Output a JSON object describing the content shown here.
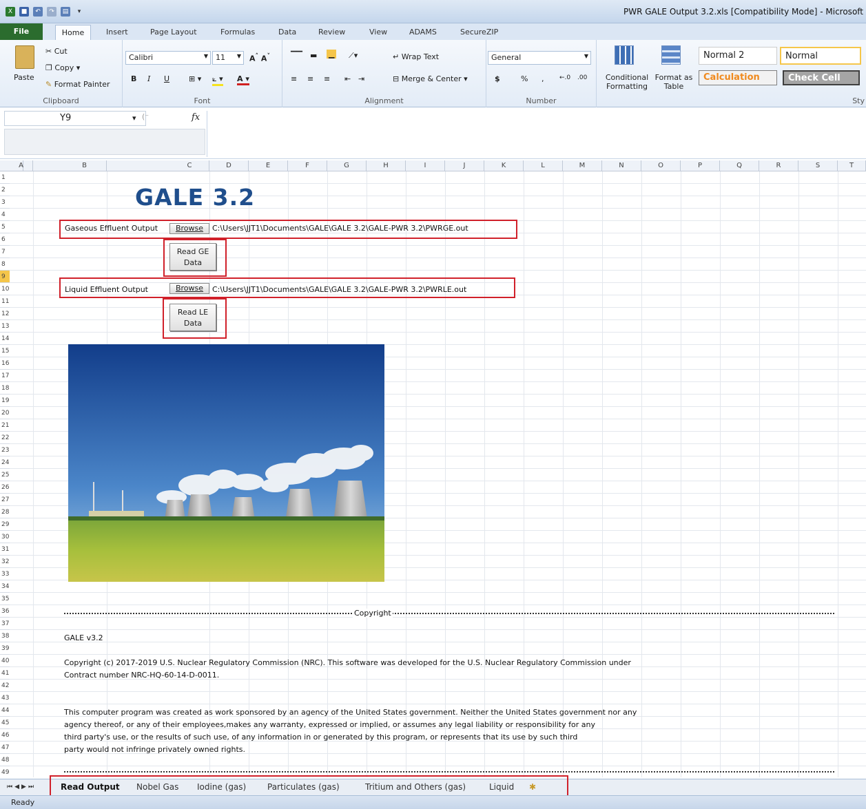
{
  "window": {
    "title": "PWR GALE Output 3.2.xls  [Compatibility Mode]  -  Microsoft"
  },
  "ribbon_tabs": [
    "File",
    "Home",
    "Insert",
    "Page Layout",
    "Formulas",
    "Data",
    "Review",
    "View",
    "ADAMS",
    "SecureZIP"
  ],
  "clipboard": {
    "cut": "Cut",
    "copy": "Copy",
    "paste": "Paste",
    "format_painter": "Format Painter",
    "label": "Clipboard"
  },
  "font": {
    "name": "Calibri",
    "size": "11",
    "bold": "B",
    "italic": "I",
    "underline": "U",
    "label": "Font"
  },
  "alignment": {
    "wrap_text": "Wrap Text",
    "merge_center": "Merge & Center",
    "label": "Alignment"
  },
  "number": {
    "format": "General",
    "currency": "$",
    "percent": "%",
    "comma": ",",
    "label": "Number"
  },
  "styles": {
    "conditional_formatting": "Conditional Formatting",
    "format_as_table": "Format as Table",
    "normal2": "Normal 2",
    "normal": "Normal",
    "calculation": "Calculation",
    "check_cell": "Check Cell",
    "label": "Sty"
  },
  "formula_bar": {
    "name_box": "Y9",
    "fx": "fx",
    "value": ""
  },
  "columns": [
    "A",
    "B",
    "C",
    "D",
    "E",
    "F",
    "G",
    "H",
    "I",
    "J",
    "K",
    "L",
    "M",
    "N",
    "O",
    "P",
    "Q",
    "R",
    "S",
    "T"
  ],
  "rows": [
    "1",
    "2",
    "3",
    "4",
    "5",
    "6",
    "7",
    "8",
    "9",
    "10",
    "11",
    "12",
    "13",
    "14",
    "15",
    "16",
    "17",
    "18",
    "19",
    "20",
    "21",
    "22",
    "23",
    "24",
    "25",
    "26",
    "27",
    "28",
    "29",
    "30",
    "31",
    "32",
    "33",
    "34",
    "35",
    "36",
    "37",
    "38",
    "39",
    "40",
    "41",
    "42",
    "43",
    "44",
    "45",
    "46",
    "47",
    "48",
    "49"
  ],
  "sheet": {
    "app_title": "GALE 3.2",
    "gaseous_label": "Gaseous Effluent Output",
    "gaseous_browse": "Browse",
    "gaseous_path": "C:\\Users\\JJT1\\Documents\\GALE\\GALE 3.2\\GALE-PWR 3.2\\PWRGE.out",
    "read_ge_line1": "Read GE",
    "read_ge_line2": "Data",
    "liquid_label": "Liquid Effluent Output",
    "liquid_browse": "Browse",
    "liquid_path": "C:\\Users\\JJT1\\Documents\\GALE\\GALE 3.2\\GALE-PWR 3.2\\PWRLE.out",
    "read_le_line1": "Read LE",
    "read_le_line2": "Data",
    "copyright_header": "Copyright",
    "version": "GALE v3.2",
    "copyright_line1": "Copyright (c) 2017-2019 U.S. Nuclear Regulatory Commission (NRC).  This software was developed for the U.S. Nuclear Regulatory Commission under",
    "copyright_line2": "Contract number NRC-HQ-60-14-D-0011.",
    "disclaimer_line1": "This computer program was created as work sponsored by an agency of the United States government.  Neither the United States government nor any",
    "disclaimer_line2": "agency thereof, or any of their employees,makes any warranty, expressed or implied, or assumes any legal liability or responsibility for any",
    "disclaimer_line3": "third party's use, or the results of such use, of any information in or generated by this program, or represents that its use by such third",
    "disclaimer_line4": "party would not infringe privately owned rights."
  },
  "sheet_tabs": [
    "Read Output",
    "Nobel Gas",
    "Iodine (gas)",
    "Particulates (gas)",
    "Tritium and Others (gas)",
    "Liquid"
  ],
  "status": "Ready",
  "colors": {
    "accent_red": "#d0202a",
    "title_blue": "#1f4e8c",
    "file_green": "#2b6c2e"
  }
}
